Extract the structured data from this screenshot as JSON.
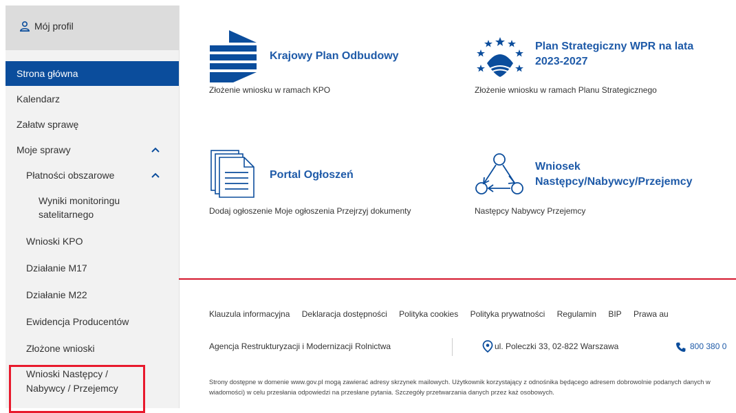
{
  "sidebar": {
    "profile_label": "Mój profil",
    "items": [
      {
        "label": "Strona główna"
      },
      {
        "label": "Kalendarz"
      },
      {
        "label": "Załatw sprawę"
      },
      {
        "label": "Moje sprawy"
      },
      {
        "label": "Płatności obszarowe"
      },
      {
        "label": "Wyniki monitoringu satelitarnego"
      },
      {
        "label": "Wnioski KPO"
      },
      {
        "label": "Działanie M17"
      },
      {
        "label": "Działanie M22"
      },
      {
        "label": "Ewidencja Producentów"
      },
      {
        "label": "Złożone wnioski"
      },
      {
        "label": "Wnioski Następcy / Nabywcy / Przejemcy"
      }
    ]
  },
  "tiles": {
    "kpo": {
      "title": "Krajowy Plan Odbudowy",
      "desc": "Złożenie wniosku w ramach KPO"
    },
    "wpr": {
      "title": "Plan Strategiczny WPR na lata 2023-2027",
      "desc": "Złożenie wniosku w ramach Planu Strategicznego"
    },
    "portal": {
      "title": "Portal Ogłoszeń",
      "desc": "Dodaj ogłoszenie Moje ogłoszenia Przejrzyj dokumenty"
    },
    "wniosek": {
      "title": "Wniosek Następcy/Nabywcy/Przejemcy",
      "desc": "Następcy Nabywcy Przejemcy"
    }
  },
  "footer": {
    "links": [
      "Klauzula informacyjna",
      "Deklaracja dostępności",
      "Polityka cookies",
      "Polityka prywatności",
      "Regulamin",
      "BIP",
      "Prawa au"
    ],
    "agency": "Agencja Restrukturyzacji i Modernizacji Rolnictwa",
    "address": "ul. Poleczki 33, 02-822 Warszawa",
    "phone": "800 380 0",
    "notice": "Strony dostępne w domenie www.gov.pl mogą zawierać adresy skrzynek mailowych. Użytkownik korzystający z odnośnika będącego adresem dobrowolnie podanych danych w wiadomości) w celu przesłania odpowiedzi na przesłane pytania. Szczegóły przetwarzania danych przez każ osobowych."
  },
  "colors": {
    "accent": "#0b4d9c",
    "link": "#1e5aa8",
    "divider": "#d4142a",
    "highlight": "#e8192c"
  }
}
